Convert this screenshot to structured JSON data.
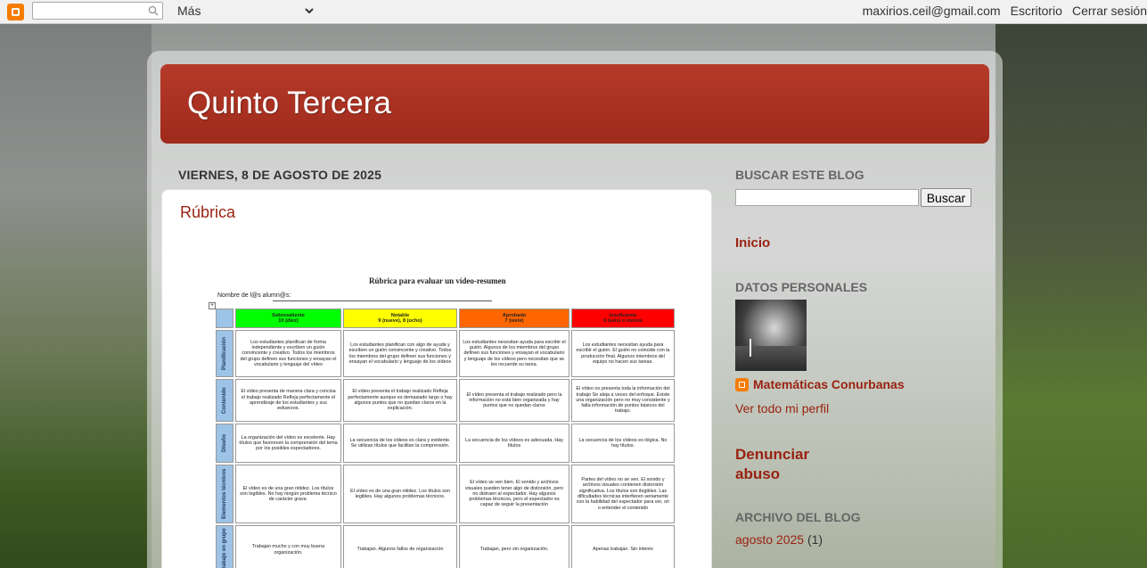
{
  "navbar": {
    "more_label": "Más",
    "email": "maxirios.ceil@gmail.com",
    "dashboard_label": "Escritorio",
    "signout_label": "Cerrar sesión"
  },
  "blog": {
    "title": "Quinto Tercera"
  },
  "post": {
    "date": "VIERNES, 8 DE AGOSTO DE 2025",
    "title": "Rúbrica"
  },
  "rubric": {
    "title": "Rúbrica para evaluar un vídeo-resumen",
    "name_label": "Nombre de l@s alumn@s:",
    "headers": [
      {
        "label": "Sobresaliente",
        "sub": "10 (diez)",
        "color": "#00ff00"
      },
      {
        "label": "Notable",
        "sub": "9 (nueve), 8 (ocho)",
        "color": "#ffff00"
      },
      {
        "label": "Aprobado",
        "sub": "7 (siete)",
        "color": "#ff6600"
      },
      {
        "label": "Insuficiente",
        "sub": "6 (seis) o menos",
        "color": "#ff0000"
      }
    ],
    "rows": [
      {
        "criterion": "Planificación",
        "cells": [
          "Los estudiantes planifican de forma independiente y escriben un guión convincente y creativo. Todos los miembros del grupo definen sus funciones y ensayan el vocabulario y lenguaje del vídeo",
          "Los estudiantes planifican con algo de ayuda y escriben un guión convincente y creativo. Todos los miembros del grupo definen sus funciones y ensayan el vocabulario y lenguaje de los vídeos",
          "Los estudiantes necesitan ayuda para escribir el guión. Algunos de los miembros del grupo definen sus funciones y ensayan el vocabulario y lenguaje de los vídeos pero necesitan que se les recuerde su tarea.",
          "Los estudiantes necesitan ayuda para escribir el guión. El guión no coincide con la producción final. Algunos miembros del equipo no hacen sus tareas."
        ]
      },
      {
        "criterion": "Contenido",
        "cells": [
          "El vídeo presenta de manera clara y concisa el trabajo realizado Refleja perfectamente el aprendizaje de los estudiantes y sus esfuerzos.",
          "El vídeo presenta el trabajo realizado Refleja perfectamente aunque es demasiado largo o hay algunos puntos que no quedan claros en la explicación.",
          "El vídeo presenta el trabajo realizado pero la información no está bien organizada y hay puntos que no quedan claros",
          "El vídeo no presenta toda la información del trabajo Se aleja a veces del enfoque. Existe una organización pero no muy consistente y falta información de puntos básicos del trabajo."
        ]
      },
      {
        "criterion": "Diseño",
        "cells": [
          "La organización del vídeo es excelente. Hay títulos que favorecen la comprensión del tema por los posibles espectadores.",
          "La secuencia de los vídeos es clara y evidente. Se utilizan títulos que facilitan la comprensión.",
          "La secuencia de los vídeos es adecuada. Hay títulos",
          "La secuencia de los vídeos es ilógica. No hay títulos."
        ]
      },
      {
        "criterion": "Elementos técnicos",
        "cells": [
          "El vídeo es de una gran nitidez. Los títulos son legibles. No hay ningún problema técnico de carácter grave.",
          "El vídeo es de una gran nitidez. Los títulos son legibles. Hay algunos problemas técnicos.",
          "El vídeo se ven bien. El sonido y archivos visuales pueden tener algo de distorsión, pero no distraen al espectador. Hay algunos problemas técnicos, pero el espectador es capaz de seguir la presentación",
          "Partes del vídeo no se ven. El sonido y archivos visuales contienen distorsión significativa. Los títulos son ilegibles. Las dificultades técnicas interfieren seriamente con la habilidad del espectador para ver, oír o entender el contenido"
        ]
      },
      {
        "criterion": "Trabajo en grupo",
        "cells": [
          "Trabajan mucho y con muy buena organización.",
          "Trabajan. Algunos fallos de organización",
          "Trabajan, pero sin organización.",
          "Apenas trabajan. Sin interés"
        ]
      }
    ]
  },
  "sidebar": {
    "search_heading": "BUSCAR ESTE BLOG",
    "search_button": "Buscar",
    "home_link": "Inicio",
    "profile_heading": "DATOS PERSONALES",
    "profile_name": "Matemáticas Conurbanas",
    "profile_link": "Ver todo mi perfil",
    "report_line1": "Denunciar",
    "report_line2": "abuso",
    "archive_heading": "ARCHIVO DEL BLOG",
    "archive_month": "agosto 2025",
    "archive_count": "(1)"
  }
}
